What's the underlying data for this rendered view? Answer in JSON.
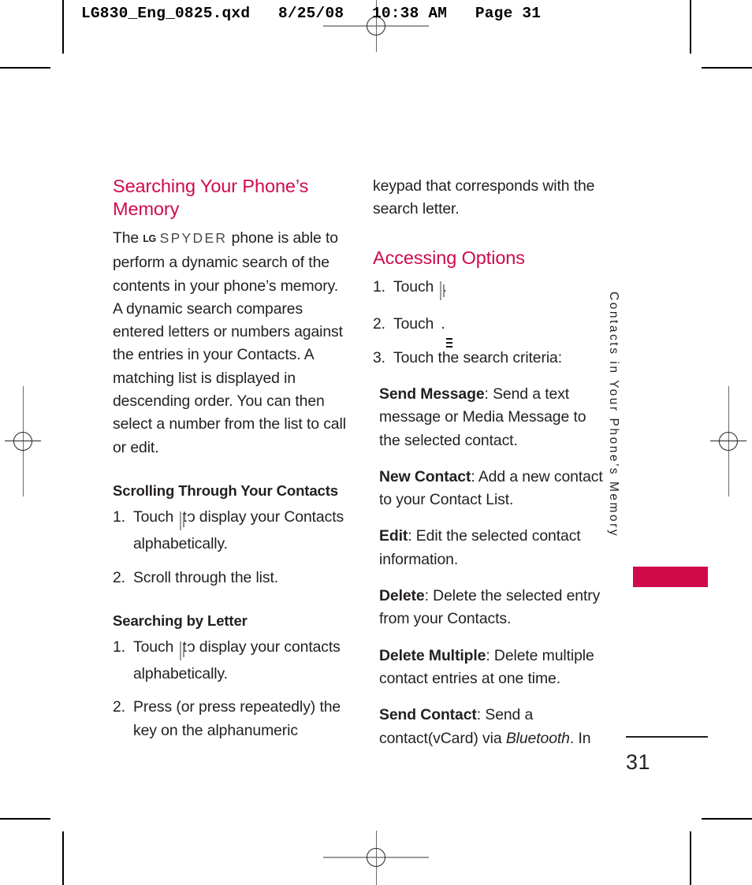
{
  "slug": {
    "text": "LG830_Eng_0825.qxd   8/25/08   10:38 AM   Page 31"
  },
  "colors": {
    "accent": "#cf0a4b",
    "body_text": "#231f20",
    "icon_dark": "#121212",
    "icon_gray": "#c4c4c4"
  },
  "left_column": {
    "heading": "Searching Your Phone’s Memory",
    "intro_before_logo": "The",
    "logo": {
      "lg": "LG",
      "model": "SPYDER"
    },
    "intro_after_logo": "phone is able to perform a dynamic search of the contents in your phone’s memory. A dynamic search compares entered letters or numbers against the entries in your Contacts. A matching list is displayed in descending order. You can then select a number from the list to call or edit.",
    "subhead_1": "Scrolling Through Your Contacts",
    "steps_1": [
      {
        "num": "1.",
        "before_icon": "Touch",
        "icon": "phone-icon",
        "after_icon": "to display your Contacts alphabetically."
      },
      {
        "num": "2.",
        "before_icon": "Scroll through the list.",
        "icon": "",
        "after_icon": ""
      }
    ],
    "subhead_2": "Searching by Letter",
    "steps_2": [
      {
        "num": "1.",
        "before_icon": "Touch",
        "icon": "phone-icon",
        "after_icon": "to display your contacts alphabetically."
      },
      {
        "num": "2.",
        "before_icon": "Press (or press repeatedly) the key on the alphanumeric",
        "icon": "",
        "after_icon": ""
      }
    ]
  },
  "right_column": {
    "continuation": "keypad that corresponds with the search letter.",
    "heading": "Accessing Options",
    "steps": [
      {
        "num": "1.",
        "before_icon": "Touch",
        "icon": "phone-icon",
        "after_icon": "."
      },
      {
        "num": "2.",
        "before_icon": "Touch",
        "icon": "menu-icon",
        "after_icon": "."
      },
      {
        "num": "3.",
        "before_icon": "Touch the search criteria:",
        "icon": "",
        "after_icon": ""
      }
    ],
    "definitions": [
      {
        "term": "Send Message",
        "desc": ": Send a text message or Media Message to the selected contact."
      },
      {
        "term": "New Contact",
        "desc": ": Add a new contact to your Contact List."
      },
      {
        "term": "Edit",
        "desc": ": Edit the selected contact information."
      },
      {
        "term": "Delete",
        "desc": ": Delete the selected entry from your Contacts."
      },
      {
        "term": "Delete Multiple",
        "desc": ": Delete multiple contact entries at one time."
      },
      {
        "term": "Send Contact",
        "desc_pre": ": Send a contact(vCard) via ",
        "desc_italic": "Bluetooth",
        "desc_post": ". In"
      }
    ]
  },
  "side_tab": {
    "label": "Contacts in Your Phone’s Memory"
  },
  "folio": {
    "page_number": "31"
  }
}
